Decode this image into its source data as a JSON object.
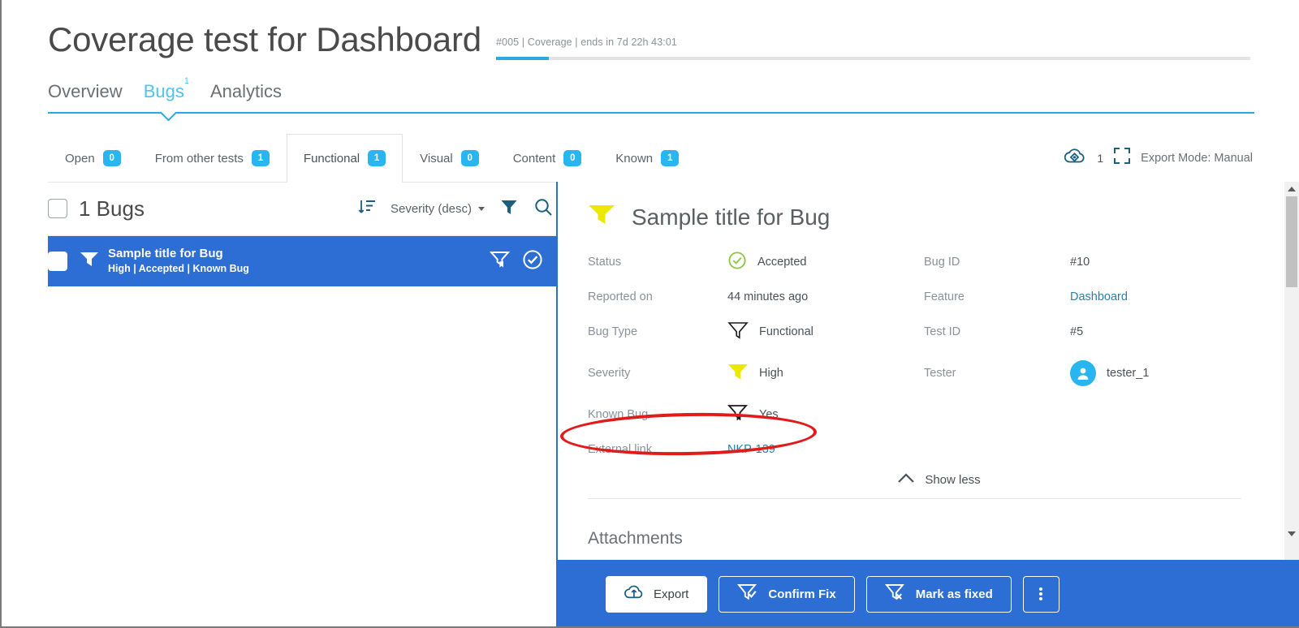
{
  "header": {
    "title": "Coverage test for Dashboard",
    "meta": "#005 | Coverage | ends in 7d 22h 43:01",
    "progress_percent": 7,
    "accent_color": "#29abe2"
  },
  "nav_tabs": [
    {
      "label": "Overview",
      "active": false,
      "superscript": ""
    },
    {
      "label": "Bugs",
      "active": true,
      "superscript": "1"
    },
    {
      "label": "Analytics",
      "active": false,
      "superscript": ""
    }
  ],
  "subtabs": [
    {
      "label": "Open",
      "count": "0",
      "active": false
    },
    {
      "label": "From other tests",
      "count": "1",
      "active": false
    },
    {
      "label": "Functional",
      "count": "1",
      "active": true
    },
    {
      "label": "Visual",
      "count": "0",
      "active": false
    },
    {
      "label": "Content",
      "count": "0",
      "active": false
    },
    {
      "label": "Known",
      "count": "1",
      "active": false
    }
  ],
  "subtabs_right": {
    "integration_count": "1",
    "export_mode": "Export Mode: Manual"
  },
  "list_pane": {
    "count_label": "1 Bugs",
    "sort_label": "Severity (desc)",
    "rows": [
      {
        "title": "Sample title for Bug",
        "subtitle": "High | Accepted | Known Bug",
        "selected": true
      }
    ]
  },
  "detail": {
    "title": "Sample title for Bug",
    "fields_left": [
      {
        "label": "Status",
        "value": "Accepted",
        "icon": "check-circle-green"
      },
      {
        "label": "Reported on",
        "value": "44 minutes ago",
        "icon": ""
      },
      {
        "label": "Bug Type",
        "value": "Functional",
        "icon": "funnel-outline"
      },
      {
        "label": "Severity",
        "value": "High",
        "icon": "funnel-yellow"
      },
      {
        "label": "Known Bug",
        "value": "Yes",
        "icon": "funnel-bookmark"
      },
      {
        "label": "External link",
        "value": "NKP-139",
        "icon": "",
        "style": "link"
      }
    ],
    "fields_right": [
      {
        "label": "Bug ID",
        "value": "#10",
        "icon": ""
      },
      {
        "label": "Feature",
        "value": "Dashboard",
        "icon": "",
        "style": "feature"
      },
      {
        "label": "Test ID",
        "value": "#5",
        "icon": ""
      },
      {
        "label": "Tester",
        "value": "tester_1",
        "icon": "avatar"
      }
    ],
    "show_less_label": "Show less",
    "attachments_title": "Attachments",
    "attachment_color": "#8fada7"
  },
  "action_bar": {
    "background": "#2d6ed4",
    "buttons": [
      {
        "label": "Export",
        "icon": "cloud-upload-icon",
        "style": "light"
      },
      {
        "label": "Confirm Fix",
        "icon": "funnel-check-icon",
        "style": "outline"
      },
      {
        "label": "Mark as fixed",
        "icon": "funnel-x-icon",
        "style": "outline"
      },
      {
        "label": "",
        "icon": "kebab-menu-icon",
        "style": "kebab"
      }
    ]
  },
  "annotation": {
    "shape": "ellipse",
    "color": "#e01b1b",
    "targets": "External link NKP-139"
  }
}
